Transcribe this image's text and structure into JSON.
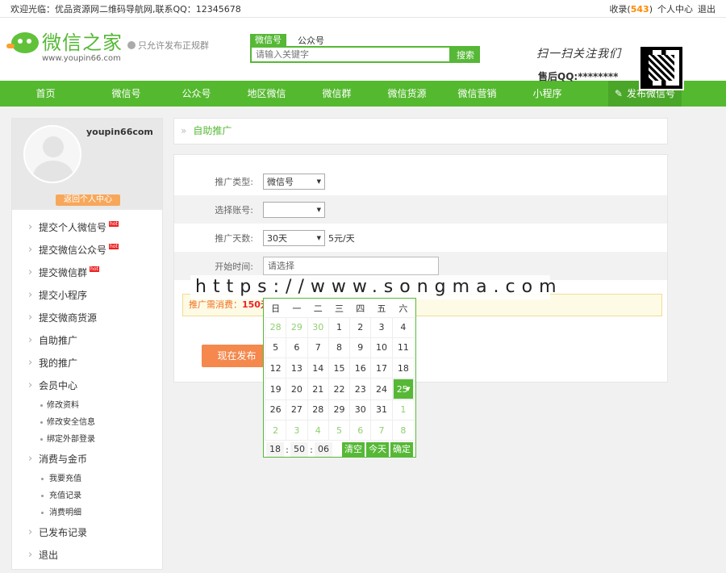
{
  "topbar": {
    "welcome": "欢迎光临：优品资源网二维码导航网,联系QQ：12345678",
    "fav": "收录(",
    "fav_count": "543",
    "fav_close": ")",
    "user_center": "个人中心",
    "logout": "退出"
  },
  "header": {
    "brand": "微信之家",
    "url": "www.youpin66.com",
    "tag": "只允许发布正规群",
    "search_tabs": [
      "微信号",
      "公众号"
    ],
    "search_placeholder": "请输入关键字",
    "search_btn": "搜索",
    "follow": "扫一扫关注我们",
    "service": "售后QQ:********"
  },
  "nav": {
    "items": [
      "首页",
      "微信号",
      "公众号",
      "地区微信",
      "微信群",
      "微信货源",
      "微信营销",
      "小程序"
    ],
    "publish": "发布微信号"
  },
  "sidebar": {
    "username": "youpin66com",
    "back": "返回个人中心",
    "menu": [
      {
        "t": "提交个人微信号",
        "hot": "hot"
      },
      {
        "t": "提交微信公众号",
        "hot": "hot"
      },
      {
        "t": "提交微信群",
        "hot": "hot"
      },
      {
        "t": "提交小程序"
      },
      {
        "t": "提交微商货源"
      },
      {
        "t": "自助推广"
      },
      {
        "t": "我的推广"
      },
      {
        "t": "会员中心"
      }
    ],
    "member_sub": [
      "修改资料",
      "修改安全信息",
      "绑定外部登录"
    ],
    "coin": "消费与金币",
    "coin_sub": [
      "我要充值",
      "充值记录",
      "消费明细"
    ],
    "published": "已发布记录",
    "exit": "退出"
  },
  "crumb": "自助推广",
  "form": {
    "type_label": "推广类型:",
    "type_value": "微信号",
    "account_label": "选择账号:",
    "account_value": "",
    "days_label": "推广天数:",
    "days_value": "30天",
    "price": "5元/天",
    "start_label": "开始时间:",
    "start_placeholder": "请选择"
  },
  "notice": {
    "prefix": "推广需消费：",
    "amount": "150元",
    "suffix": ""
  },
  "publish_btn": "现在发布",
  "watermark": "https://www.songma.com",
  "calendar": {
    "weekdays": [
      "日",
      "一",
      "二",
      "三",
      "四",
      "五",
      "六"
    ],
    "weeks": [
      [
        "28",
        "29",
        "30",
        "1",
        "2",
        "3",
        "4"
      ],
      [
        "5",
        "6",
        "7",
        "8",
        "9",
        "10",
        "11"
      ],
      [
        "12",
        "13",
        "14",
        "15",
        "16",
        "17",
        "18"
      ],
      [
        "19",
        "20",
        "21",
        "22",
        "23",
        "24",
        "25"
      ],
      [
        "26",
        "27",
        "28",
        "29",
        "30",
        "31",
        "1"
      ],
      [
        "2",
        "3",
        "4",
        "5",
        "6",
        "7",
        "8"
      ]
    ],
    "selected": "25",
    "hour": "18",
    "minute": "50",
    "second": "06",
    "clear": "清空",
    "today": "今天",
    "ok": "确定"
  }
}
